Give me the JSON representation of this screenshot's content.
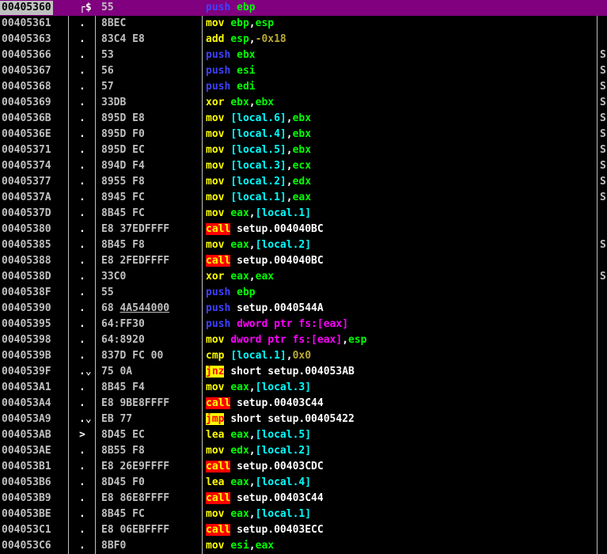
{
  "rows": [
    {
      "addr": "00405360",
      "mark": "┌$",
      "hex": [
        {
          "t": "55"
        }
      ],
      "ins": [
        {
          "t": "push",
          "c": "b"
        },
        {
          "t": " "
        },
        {
          "t": "ebp",
          "c": "g"
        }
      ],
      "cmt": "",
      "sel": true
    },
    {
      "addr": "00405361",
      "mark": ".",
      "hex": [
        {
          "t": "8BEC"
        }
      ],
      "ins": [
        {
          "t": "mov",
          "c": "y"
        },
        {
          "t": " "
        },
        {
          "t": "ebp",
          "c": "g"
        },
        {
          "t": ",",
          "c": "w"
        },
        {
          "t": "esp",
          "c": "g"
        }
      ],
      "cmt": ""
    },
    {
      "addr": "00405363",
      "mark": ".",
      "hex": [
        {
          "t": "83C4 E8"
        }
      ],
      "ins": [
        {
          "t": "add",
          "c": "y"
        },
        {
          "t": " "
        },
        {
          "t": "esp",
          "c": "g"
        },
        {
          "t": ",",
          "c": "w"
        },
        {
          "t": "-0x18",
          "c": "o"
        }
      ],
      "cmt": ""
    },
    {
      "addr": "00405366",
      "mark": ".",
      "hex": [
        {
          "t": "53"
        }
      ],
      "ins": [
        {
          "t": "push",
          "c": "b"
        },
        {
          "t": " "
        },
        {
          "t": "ebx",
          "c": "g"
        }
      ],
      "cmt": "S"
    },
    {
      "addr": "00405367",
      "mark": ".",
      "hex": [
        {
          "t": "56"
        }
      ],
      "ins": [
        {
          "t": "push",
          "c": "b"
        },
        {
          "t": " "
        },
        {
          "t": "esi",
          "c": "g"
        }
      ],
      "cmt": "S"
    },
    {
      "addr": "00405368",
      "mark": ".",
      "hex": [
        {
          "t": "57"
        }
      ],
      "ins": [
        {
          "t": "push",
          "c": "b"
        },
        {
          "t": " "
        },
        {
          "t": "edi",
          "c": "g"
        }
      ],
      "cmt": "S"
    },
    {
      "addr": "00405369",
      "mark": ".",
      "hex": [
        {
          "t": "33DB"
        }
      ],
      "ins": [
        {
          "t": "xor",
          "c": "y"
        },
        {
          "t": " "
        },
        {
          "t": "ebx",
          "c": "g"
        },
        {
          "t": ",",
          "c": "w"
        },
        {
          "t": "ebx",
          "c": "g"
        }
      ],
      "cmt": "S"
    },
    {
      "addr": "0040536B",
      "mark": ".",
      "hex": [
        {
          "t": "895D E8"
        }
      ],
      "ins": [
        {
          "t": "mov",
          "c": "y"
        },
        {
          "t": " "
        },
        {
          "t": "[local.6]",
          "c": "c"
        },
        {
          "t": ",",
          "c": "w"
        },
        {
          "t": "ebx",
          "c": "g"
        }
      ],
      "cmt": "S"
    },
    {
      "addr": "0040536E",
      "mark": ".",
      "hex": [
        {
          "t": "895D F0"
        }
      ],
      "ins": [
        {
          "t": "mov",
          "c": "y"
        },
        {
          "t": " "
        },
        {
          "t": "[local.4]",
          "c": "c"
        },
        {
          "t": ",",
          "c": "w"
        },
        {
          "t": "ebx",
          "c": "g"
        }
      ],
      "cmt": "S"
    },
    {
      "addr": "00405371",
      "mark": ".",
      "hex": [
        {
          "t": "895D EC"
        }
      ],
      "ins": [
        {
          "t": "mov",
          "c": "y"
        },
        {
          "t": " "
        },
        {
          "t": "[local.5]",
          "c": "c"
        },
        {
          "t": ",",
          "c": "w"
        },
        {
          "t": "ebx",
          "c": "g"
        }
      ],
      "cmt": "S"
    },
    {
      "addr": "00405374",
      "mark": ".",
      "hex": [
        {
          "t": "894D F4"
        }
      ],
      "ins": [
        {
          "t": "mov",
          "c": "y"
        },
        {
          "t": " "
        },
        {
          "t": "[local.3]",
          "c": "c"
        },
        {
          "t": ",",
          "c": "w"
        },
        {
          "t": "ecx",
          "c": "g"
        }
      ],
      "cmt": "S"
    },
    {
      "addr": "00405377",
      "mark": ".",
      "hex": [
        {
          "t": "8955 F8"
        }
      ],
      "ins": [
        {
          "t": "mov",
          "c": "y"
        },
        {
          "t": " "
        },
        {
          "t": "[local.2]",
          "c": "c"
        },
        {
          "t": ",",
          "c": "w"
        },
        {
          "t": "edx",
          "c": "g"
        }
      ],
      "cmt": "S"
    },
    {
      "addr": "0040537A",
      "mark": ".",
      "hex": [
        {
          "t": "8945 FC"
        }
      ],
      "ins": [
        {
          "t": "mov",
          "c": "y"
        },
        {
          "t": " "
        },
        {
          "t": "[local.1]",
          "c": "c"
        },
        {
          "t": ",",
          "c": "w"
        },
        {
          "t": "eax",
          "c": "g"
        }
      ],
      "cmt": "S"
    },
    {
      "addr": "0040537D",
      "mark": ".",
      "hex": [
        {
          "t": "8B45 FC"
        }
      ],
      "ins": [
        {
          "t": "mov",
          "c": "y"
        },
        {
          "t": " "
        },
        {
          "t": "eax",
          "c": "g"
        },
        {
          "t": ",",
          "c": "w"
        },
        {
          "t": "[local.1]",
          "c": "c"
        }
      ],
      "cmt": ""
    },
    {
      "addr": "00405380",
      "mark": ".",
      "hex": [
        {
          "t": "E8 37EDFFFF"
        }
      ],
      "ins": [
        {
          "t": "call",
          "c": "call"
        },
        {
          "t": " "
        },
        {
          "t": "setup.004040BC",
          "c": "w"
        }
      ],
      "cmt": ""
    },
    {
      "addr": "00405385",
      "mark": ".",
      "hex": [
        {
          "t": "8B45 F8"
        }
      ],
      "ins": [
        {
          "t": "mov",
          "c": "y"
        },
        {
          "t": " "
        },
        {
          "t": "eax",
          "c": "g"
        },
        {
          "t": ",",
          "c": "w"
        },
        {
          "t": "[local.2]",
          "c": "c"
        }
      ],
      "cmt": "S"
    },
    {
      "addr": "00405388",
      "mark": ".",
      "hex": [
        {
          "t": "E8 2FEDFFFF"
        }
      ],
      "ins": [
        {
          "t": "call",
          "c": "call"
        },
        {
          "t": " "
        },
        {
          "t": "setup.004040BC",
          "c": "w"
        }
      ],
      "cmt": ""
    },
    {
      "addr": "0040538D",
      "mark": ".",
      "hex": [
        {
          "t": "33C0"
        }
      ],
      "ins": [
        {
          "t": "xor",
          "c": "y"
        },
        {
          "t": " "
        },
        {
          "t": "eax",
          "c": "g"
        },
        {
          "t": ",",
          "c": "w"
        },
        {
          "t": "eax",
          "c": "g"
        }
      ],
      "cmt": "S"
    },
    {
      "addr": "0040538F",
      "mark": ".",
      "hex": [
        {
          "t": "55"
        }
      ],
      "ins": [
        {
          "t": "push",
          "c": "b"
        },
        {
          "t": " "
        },
        {
          "t": "ebp",
          "c": "g"
        }
      ],
      "cmt": ""
    },
    {
      "addr": "00405390",
      "mark": ".",
      "hex": [
        {
          "t": "68 "
        },
        {
          "t": "4A544000",
          "u": true
        }
      ],
      "ins": [
        {
          "t": "push",
          "c": "b"
        },
        {
          "t": " "
        },
        {
          "t": "setup.0040544A",
          "c": "w"
        }
      ],
      "cmt": ""
    },
    {
      "addr": "00405395",
      "mark": ".",
      "hex": [
        {
          "t": "64:FF30"
        }
      ],
      "ins": [
        {
          "t": "push",
          "c": "b"
        },
        {
          "t": " "
        },
        {
          "t": "dword ptr fs:",
          "c": "m"
        },
        {
          "t": "[eax]",
          "c": "m"
        }
      ],
      "cmt": ""
    },
    {
      "addr": "00405398",
      "mark": ".",
      "hex": [
        {
          "t": "64:8920"
        }
      ],
      "ins": [
        {
          "t": "mov",
          "c": "y"
        },
        {
          "t": " "
        },
        {
          "t": "dword ptr fs:[eax]",
          "c": "m"
        },
        {
          "t": ",",
          "c": "w"
        },
        {
          "t": "esp",
          "c": "g"
        }
      ],
      "cmt": ""
    },
    {
      "addr": "0040539B",
      "mark": ".",
      "hex": [
        {
          "t": "837D FC 00"
        }
      ],
      "ins": [
        {
          "t": "cmp",
          "c": "y"
        },
        {
          "t": " "
        },
        {
          "t": "[local.1]",
          "c": "c"
        },
        {
          "t": ",",
          "c": "w"
        },
        {
          "t": "0x0",
          "c": "o"
        }
      ],
      "cmt": ""
    },
    {
      "addr": "0040539F",
      "mark": ".⌄",
      "hex": [
        {
          "t": "75 0A"
        }
      ],
      "ins": [
        {
          "t": "jnz",
          "c": "jmp"
        },
        {
          "t": " "
        },
        {
          "t": "short setup.004053AB",
          "c": "w"
        }
      ],
      "cmt": ""
    },
    {
      "addr": "004053A1",
      "mark": ".",
      "hex": [
        {
          "t": "8B45 F4"
        }
      ],
      "ins": [
        {
          "t": "mov",
          "c": "y"
        },
        {
          "t": " "
        },
        {
          "t": "eax",
          "c": "g"
        },
        {
          "t": ",",
          "c": "w"
        },
        {
          "t": "[local.3]",
          "c": "c"
        }
      ],
      "cmt": ""
    },
    {
      "addr": "004053A4",
      "mark": ".",
      "hex": [
        {
          "t": "E8 9BE8FFFF"
        }
      ],
      "ins": [
        {
          "t": "call",
          "c": "call"
        },
        {
          "t": " "
        },
        {
          "t": "setup.00403C44",
          "c": "w"
        }
      ],
      "cmt": ""
    },
    {
      "addr": "004053A9",
      "mark": ".⌄",
      "hex": [
        {
          "t": "EB 77"
        }
      ],
      "ins": [
        {
          "t": "jmp",
          "c": "jmp"
        },
        {
          "t": " "
        },
        {
          "t": "short setup.00405422",
          "c": "w"
        }
      ],
      "cmt": ""
    },
    {
      "addr": "004053AB",
      "mark": ">",
      "hex": [
        {
          "t": "8D45 EC"
        }
      ],
      "ins": [
        {
          "t": "lea",
          "c": "y"
        },
        {
          "t": " "
        },
        {
          "t": "eax",
          "c": "g"
        },
        {
          "t": ",",
          "c": "w"
        },
        {
          "t": "[local.5]",
          "c": "c"
        }
      ],
      "cmt": ""
    },
    {
      "addr": "004053AE",
      "mark": ".",
      "hex": [
        {
          "t": "8B55 F8"
        }
      ],
      "ins": [
        {
          "t": "mov",
          "c": "y"
        },
        {
          "t": " "
        },
        {
          "t": "edx",
          "c": "g"
        },
        {
          "t": ",",
          "c": "w"
        },
        {
          "t": "[local.2]",
          "c": "c"
        }
      ],
      "cmt": ""
    },
    {
      "addr": "004053B1",
      "mark": ".",
      "hex": [
        {
          "t": "E8 26E9FFFF"
        }
      ],
      "ins": [
        {
          "t": "call",
          "c": "call"
        },
        {
          "t": " "
        },
        {
          "t": "setup.00403CDC",
          "c": "w"
        }
      ],
      "cmt": ""
    },
    {
      "addr": "004053B6",
      "mark": ".",
      "hex": [
        {
          "t": "8D45 F0"
        }
      ],
      "ins": [
        {
          "t": "lea",
          "c": "y"
        },
        {
          "t": " "
        },
        {
          "t": "eax",
          "c": "g"
        },
        {
          "t": ",",
          "c": "w"
        },
        {
          "t": "[local.4]",
          "c": "c"
        }
      ],
      "cmt": ""
    },
    {
      "addr": "004053B9",
      "mark": ".",
      "hex": [
        {
          "t": "E8 86E8FFFF"
        }
      ],
      "ins": [
        {
          "t": "call",
          "c": "call"
        },
        {
          "t": " "
        },
        {
          "t": "setup.00403C44",
          "c": "w"
        }
      ],
      "cmt": ""
    },
    {
      "addr": "004053BE",
      "mark": ".",
      "hex": [
        {
          "t": "8B45 FC"
        }
      ],
      "ins": [
        {
          "t": "mov",
          "c": "y"
        },
        {
          "t": " "
        },
        {
          "t": "eax",
          "c": "g"
        },
        {
          "t": ",",
          "c": "w"
        },
        {
          "t": "[local.1]",
          "c": "c"
        }
      ],
      "cmt": ""
    },
    {
      "addr": "004053C1",
      "mark": ".",
      "hex": [
        {
          "t": "E8 06EBFFFF"
        }
      ],
      "ins": [
        {
          "t": "call",
          "c": "call"
        },
        {
          "t": " "
        },
        {
          "t": "setup.00403ECC",
          "c": "w"
        }
      ],
      "cmt": ""
    },
    {
      "addr": "004053C6",
      "mark": ".",
      "hex": [
        {
          "t": "8BF0"
        }
      ],
      "ins": [
        {
          "t": "mov",
          "c": "y"
        },
        {
          "t": " "
        },
        {
          "t": "esi",
          "c": "g"
        },
        {
          "t": ",",
          "c": "w"
        },
        {
          "t": "eax",
          "c": "g"
        }
      ],
      "cmt": ""
    }
  ]
}
